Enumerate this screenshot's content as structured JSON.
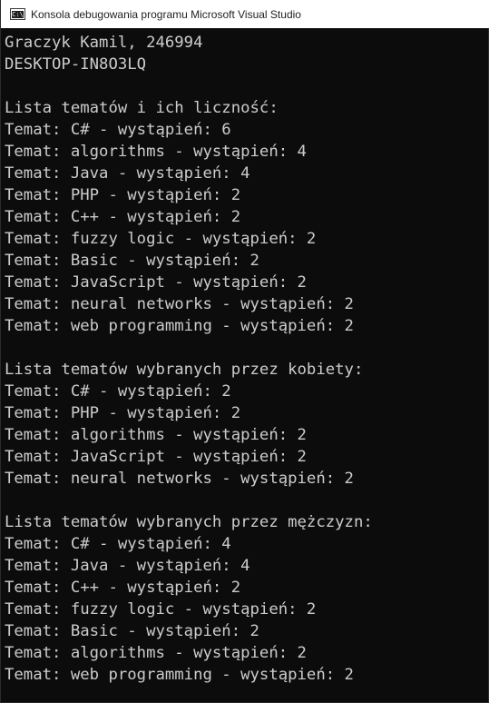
{
  "window": {
    "title": "Konsola debugowania programu Microsoft Visual Studio",
    "icon_label": "C:\\",
    "icon_name": "vs-debug-console-icon"
  },
  "console": {
    "text_color": "#cccccc",
    "background": "#0c0c0c",
    "lines": [
      "Graczyk Kamil, 246994",
      "DESKTOP-IN8O3LQ",
      "",
      "Lista tematów i ich liczność:",
      "Temat: C# - wystąpień: 6",
      "Temat: algorithms - wystąpień: 4",
      "Temat: Java - wystąpień: 4",
      "Temat: PHP - wystąpień: 2",
      "Temat: C++ - wystąpień: 2",
      "Temat: fuzzy logic - wystąpień: 2",
      "Temat: Basic - wystąpień: 2",
      "Temat: JavaScript - wystąpień: 2",
      "Temat: neural networks - wystąpień: 2",
      "Temat: web programming - wystąpień: 2",
      "",
      "Lista tematów wybranych przez kobiety:",
      "Temat: C# - wystąpień: 2",
      "Temat: PHP - wystąpień: 2",
      "Temat: algorithms - wystąpień: 2",
      "Temat: JavaScript - wystąpień: 2",
      "Temat: neural networks - wystąpień: 2",
      "",
      "Lista tematów wybranych przez mężczyzn:",
      "Temat: C# - wystąpień: 4",
      "Temat: Java - wystąpień: 4",
      "Temat: C++ - wystąpień: 2",
      "Temat: fuzzy logic - wystąpień: 2",
      "Temat: Basic - wystąpień: 2",
      "Temat: algorithms - wystąpień: 2",
      "Temat: web programming - wystąpień: 2"
    ]
  }
}
